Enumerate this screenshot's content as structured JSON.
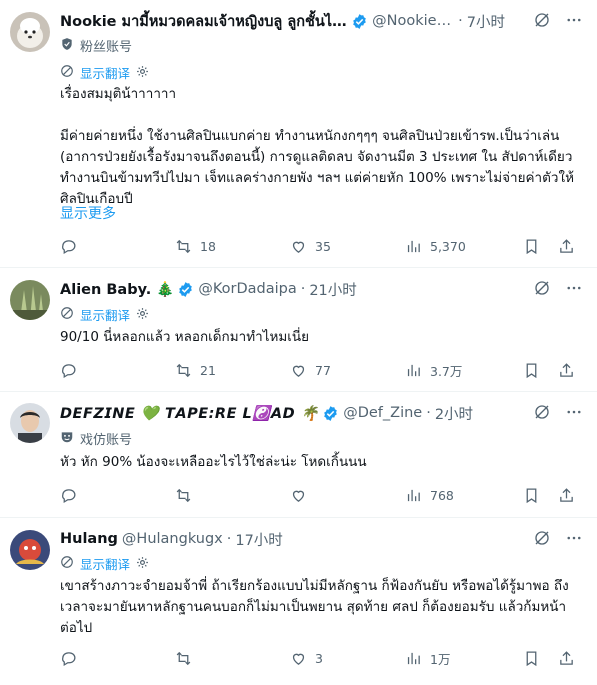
{
  "tweets": [
    {
      "name": "Nookie มามี้หมวดคลมเจ้าหญิงบลู ลูกชั้นไม่ไ...",
      "handle": "@Nookie_1...",
      "sep": "·",
      "time": "7小时",
      "tag": "粉丝账号",
      "translate": "显示翻译",
      "text_lines": [
        "เรื่องสมมุติน้าาาาาา",
        "",
        "มีค่ายค่ายหนึ่ง ใช้งานศิลปินแบกค่าย ทำงานหนักงกๆๆๆ จนศิลปินป่วยเข้ารพ.เป็นว่าเล่น (อาการป่วยยังเรื้อรังมาจนถึงตอนนี้) การดูแลติดลบ จัดงานมีต 3 ประเทศ ใน สัปดาห์เดียว ทำงานบินข้ามทวีปไปมา เจ็ทแลคร่างกายพัง ฯลฯ แต่ค่ายหัก 100% เพราะไม่จ่ายค่าตัวให้ศิลปินเกือบปี"
      ],
      "more": "显示更多",
      "replies": "",
      "retweets": "18",
      "likes": "35",
      "views": "5,370"
    },
    {
      "name": "Alien Baby. 🎄",
      "handle": "@KorDadaipa",
      "sep": "·",
      "time": "21小时",
      "translate": "显示翻译",
      "text_lines": [
        "90/10 นี่หลอกแล้ว หลอกเด็กมาทำไหมเนี่ย"
      ],
      "replies": "",
      "retweets": "21",
      "likes": "77",
      "views": "3.7万"
    },
    {
      "name": "𝘿𝙀𝙁𝙕𝙄𝙉𝙀 💚 𝙏𝘼𝙋𝙀:𝙍𝙀 𝙇☯️𝘼𝘿 🌴",
      "handle": "@Def_Zine",
      "sep": "·",
      "time": "2小时",
      "tag": "戏仿账号",
      "text_lines": [
        "หัว หัก 90% น้องจะเหลืออะไรไว้ใช่ล่ะน่ะ โหดเกิ้นนน"
      ],
      "replies": "",
      "retweets": "",
      "likes": "",
      "views": "768"
    },
    {
      "name": "Hulang",
      "handle": "@Hulangkugx",
      "sep": "·",
      "time": "17小时",
      "translate": "显示翻译",
      "text_lines": [
        "เขาสร้างภาวะจำยอมจ้าพี่ ถ้าเรียกร้องแบบไม่มีหลักฐาน ก็ฟ้องกันยับ หรือพอได้รู้มาพอ ถึงเวลาจะมายันหาหลักฐานคนบอกก็ไม่มาเป็นพยาน สุดท้าย ศลป ก็ต้องยอมรับ แล้วก้มหน้าต่อไป"
      ],
      "replies": "",
      "retweets": "",
      "likes": "3",
      "views": "1万"
    }
  ],
  "colors": {
    "accent": "#1d9bf0",
    "muted": "#536471",
    "text": "#0f1419",
    "divider": "#eff3f4"
  }
}
